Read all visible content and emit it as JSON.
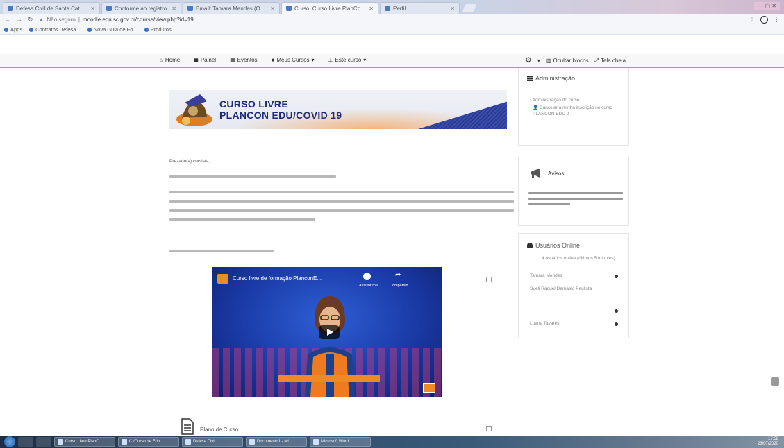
{
  "browser": {
    "tabs": [
      {
        "label": "Defesa Civil de Santa Catarina"
      },
      {
        "label": "Conforme ao registro"
      },
      {
        "label": "Email: Tamara Mendes (Outlook)"
      },
      {
        "label": "Curso: Curso Livre PlanCon Edu",
        "active": true
      },
      {
        "label": "Perfil"
      }
    ],
    "url_prefix": "Não seguro",
    "url": "moodle.edu.sc.gov.br/course/view.php?id=19",
    "bookmarks": [
      "Apps",
      "Contratos Defesa...",
      "Nova Guia de Fo...",
      "Produtos"
    ]
  },
  "moodle_nav": {
    "items": [
      "Home",
      "Painel",
      "Eventos",
      "Meus Cursos",
      "Este curso"
    ],
    "right": [
      "Ocultar blocos",
      "Tela cheia"
    ]
  },
  "banner": {
    "line1": "CURSO LIVRE",
    "line2": "PLANCON EDU/COVID 19"
  },
  "content": {
    "greeting": "Prezado(a) cursista,",
    "doc_label": "Plano de Curso"
  },
  "video": {
    "title": "Curso livre de formação PlanconE...",
    "watch_later": "Assistir ma...",
    "share": "Compartilh..."
  },
  "sidebar": {
    "admin": {
      "title": "Administração",
      "items": [
        "Administração do curso",
        "Cancelar a minha inscrição no curso PLANCON EDU 2"
      ]
    },
    "warnings": {
      "title": "Avisos"
    },
    "online": {
      "title": "Usuários Online",
      "subtitle": "4 usuários online (últimos 5 minutos)",
      "users": [
        "Tamara Mendes",
        "Sueli Raquel Damasio Paulista",
        "Luana Tavares"
      ]
    }
  },
  "taskbar": {
    "apps": [
      "Curso Livre PlanC...",
      "C:/Curso de Edu...",
      "Defesa Civil...",
      "Documento1 - Mi...",
      "Microsoft Word"
    ],
    "time": "17:58",
    "date": "23/07/2020"
  },
  "colors": {
    "accent_orange": "#f08a24",
    "banner_blue": "#1f2b7a"
  }
}
